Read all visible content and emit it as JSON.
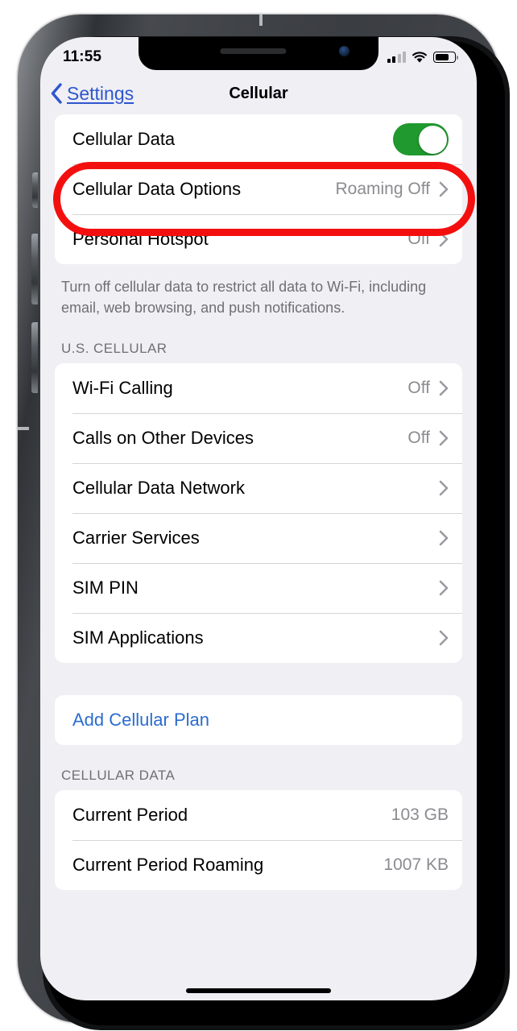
{
  "status_bar": {
    "time": "11:55",
    "signal_icon": "cellular-signal-icon",
    "signal_bars_filled": 2,
    "signal_bars_total": 4,
    "wifi_icon": "wifi-icon",
    "battery_icon": "battery-icon",
    "battery_level_percent": 62
  },
  "nav": {
    "back_label": "Settings",
    "back_icon": "chevron-left-icon",
    "title": "Cellular"
  },
  "sections": {
    "data_card": {
      "rows": [
        {
          "label": "Cellular Data",
          "control": "toggle",
          "toggle_on": true
        },
        {
          "label": "Cellular Data Options",
          "value": "Roaming Off",
          "control": "chevron"
        },
        {
          "label": "Personal Hotspot",
          "value": "Off",
          "control": "chevron"
        }
      ],
      "footer": "Turn off cellular data to restrict all data to Wi-Fi, including email, web browsing, and push notifications."
    },
    "carrier": {
      "header": "U.S. CELLULAR",
      "rows": [
        {
          "label": "Wi-Fi Calling",
          "value": "Off",
          "control": "chevron"
        },
        {
          "label": "Calls on Other Devices",
          "value": "Off",
          "control": "chevron"
        },
        {
          "label": "Cellular Data Network",
          "value": "",
          "control": "chevron"
        },
        {
          "label": "Carrier Services",
          "value": "",
          "control": "chevron"
        },
        {
          "label": "SIM PIN",
          "value": "",
          "control": "chevron"
        },
        {
          "label": "SIM Applications",
          "value": "",
          "control": "chevron"
        }
      ]
    },
    "add_plan": {
      "rows": [
        {
          "label": "Add Cellular Plan",
          "control": "link"
        }
      ]
    },
    "usage": {
      "header": "CELLULAR DATA",
      "rows": [
        {
          "label": "Current Period",
          "value": "103 GB",
          "control": "none"
        },
        {
          "label": "Current Period Roaming",
          "value": "1007 KB",
          "control": "none"
        }
      ]
    }
  },
  "annotation": {
    "shape": "oval",
    "color": "#f40f0f",
    "targets_row": "Cellular Data"
  },
  "colors": {
    "accent_blue": "#2b6ccf",
    "back_link_blue": "#2f56cf",
    "toggle_green": "#20992f",
    "value_gray": "#8b8b90",
    "header_gray": "#6f6f76",
    "screen_background": "#efeff4",
    "card_background": "#ffffff"
  }
}
